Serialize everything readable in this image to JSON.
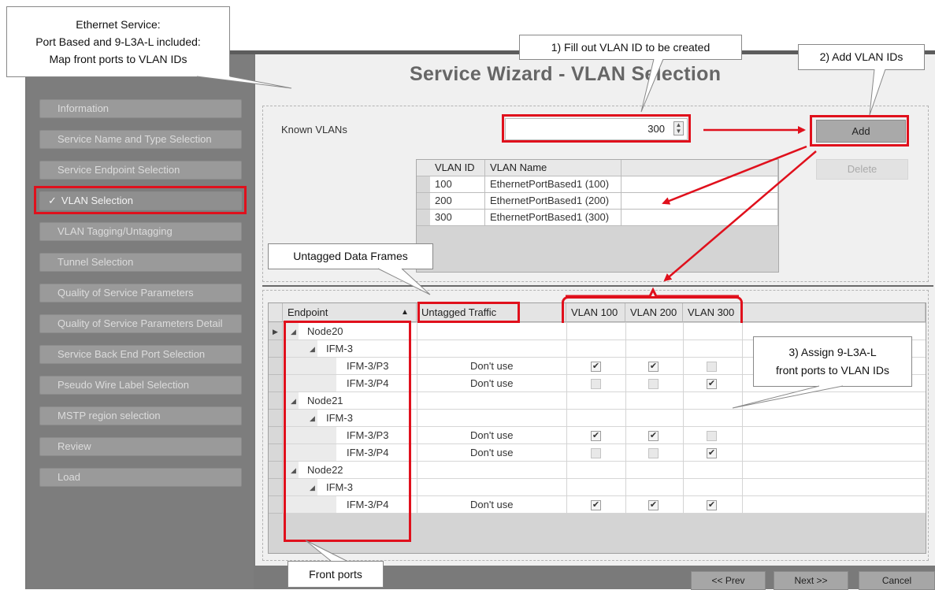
{
  "window": {
    "title": "Service Wizard - VLAN Selection",
    "known_vlans_label": "Known VLANs",
    "vlan_input_value": "300",
    "add_label": "Add",
    "delete_label": "Delete"
  },
  "sidebar": {
    "items": [
      {
        "label": "Information"
      },
      {
        "label": "Service Name and Type Selection"
      },
      {
        "label": "Service Endpoint Selection"
      },
      {
        "label": "VLAN Selection",
        "active": true
      },
      {
        "label": "VLAN Tagging/Untagging"
      },
      {
        "label": "Tunnel Selection"
      },
      {
        "label": "Quality of Service Parameters"
      },
      {
        "label": "Quality of Service Parameters Detail"
      },
      {
        "label": "Service Back End Port Selection"
      },
      {
        "label": "Pseudo Wire Label Selection"
      },
      {
        "label": "MSTP region selection"
      },
      {
        "label": "Review"
      },
      {
        "label": "Load"
      }
    ]
  },
  "vlan_table": {
    "headers": [
      "VLAN ID",
      "VLAN Name"
    ],
    "rows": [
      {
        "id": "100",
        "name": "EthernetPortBased1 (100)"
      },
      {
        "id": "200",
        "name": "EthernetPortBased1 (200)"
      },
      {
        "id": "300",
        "name": "EthernetPortBased1 (300)"
      }
    ]
  },
  "endpoint_grid": {
    "headers": {
      "endpoint": "Endpoint",
      "sort_icon": "▲",
      "untagged": "Untagged Traffic",
      "vlan100": "VLAN 100",
      "vlan200": "VLAN 200",
      "vlan300": "VLAN 300"
    },
    "rows": [
      {
        "level": 0,
        "label": "Node20"
      },
      {
        "level": 1,
        "label": "IFM-3"
      },
      {
        "level": 2,
        "label": "IFM-3/P3",
        "untagged": "Don't use",
        "v100": true,
        "v200": true,
        "v300": false
      },
      {
        "level": 2,
        "label": "IFM-3/P4",
        "untagged": "Don't use",
        "v100": false,
        "v200": false,
        "v300": true
      },
      {
        "level": 0,
        "label": "Node21"
      },
      {
        "level": 1,
        "label": "IFM-3"
      },
      {
        "level": 2,
        "label": "IFM-3/P3",
        "untagged": "Don't use",
        "v100": true,
        "v200": true,
        "v300": false
      },
      {
        "level": 2,
        "label": "IFM-3/P4",
        "untagged": "Don't use",
        "v100": false,
        "v200": false,
        "v300": true
      },
      {
        "level": 0,
        "label": "Node22"
      },
      {
        "level": 1,
        "label": "IFM-3"
      },
      {
        "level": 2,
        "label": "IFM-3/P4",
        "untagged": "Don't use",
        "v100": true,
        "v200": true,
        "v300": true
      }
    ]
  },
  "footer": {
    "prev_label": "<< Prev",
    "next_label": "Next >>",
    "cancel_label": "Cancel"
  },
  "callouts": {
    "ethernet_service": [
      "Ethernet Service:",
      "Port Based and 9-L3A-L included:",
      "Map front ports to VLAN IDs"
    ],
    "fill_vlan": "1) Fill out VLAN ID to be created",
    "add_vlan": "2) Add VLAN IDs",
    "assign_ports": [
      "3) Assign 9-L3A-L",
      "front ports to VLAN IDs"
    ],
    "untagged_frames": "Untagged Data Frames",
    "front_ports": "Front ports"
  },
  "colors": {
    "highlight": "#e0101c",
    "sidebar_bg": "#7d7d7d",
    "panel_bg": "#f0f0f0"
  }
}
